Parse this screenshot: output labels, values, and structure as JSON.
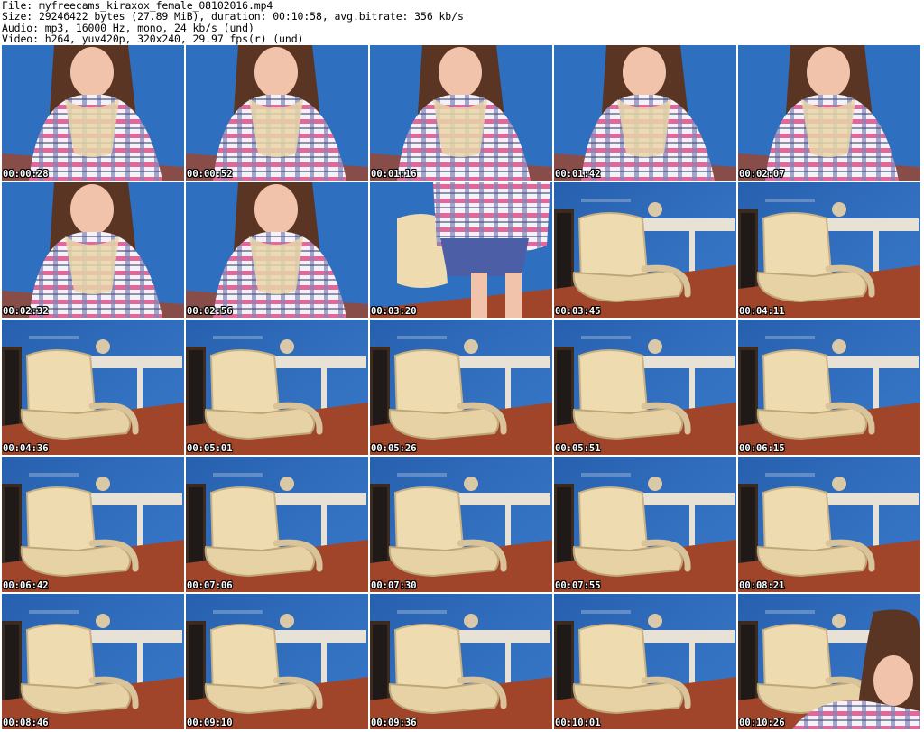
{
  "header": {
    "file_line": "File: myfreecams_kiraxox_female_08102016.mp4",
    "size_line": "Size: 29246422 bytes (27.89 MiB), duration: 00:10:58, avg.bitrate: 356 kb/s",
    "audio_line": "Audio: mp3, 16000 Hz, mono, 24 kb/s (und)",
    "video_line": "Video: h264, yuv420p, 320x240, 29.97 fps(r) (und)"
  },
  "colors": {
    "wall_blue": "#2f6fc0",
    "floor_wood": "#a0452a",
    "chair_cream": "#eedcb0",
    "shirt_pink": "#e0508c",
    "hair_brown": "#5a3524",
    "skin": "#f1c3aa"
  },
  "thumbnails": [
    {
      "time": "00:00:28",
      "scene": "person"
    },
    {
      "time": "00:00:52",
      "scene": "person"
    },
    {
      "time": "00:01:16",
      "scene": "person"
    },
    {
      "time": "00:01:42",
      "scene": "person"
    },
    {
      "time": "00:02:07",
      "scene": "person"
    },
    {
      "time": "00:02:32",
      "scene": "person"
    },
    {
      "time": "00:02:56",
      "scene": "person"
    },
    {
      "time": "00:03:20",
      "scene": "standing"
    },
    {
      "time": "00:03:45",
      "scene": "chair"
    },
    {
      "time": "00:04:11",
      "scene": "chair"
    },
    {
      "time": "00:04:36",
      "scene": "chair"
    },
    {
      "time": "00:05:01",
      "scene": "chair"
    },
    {
      "time": "00:05:26",
      "scene": "chair"
    },
    {
      "time": "00:05:51",
      "scene": "chair"
    },
    {
      "time": "00:06:15",
      "scene": "chair"
    },
    {
      "time": "00:06:42",
      "scene": "chair"
    },
    {
      "time": "00:07:06",
      "scene": "chair"
    },
    {
      "time": "00:07:30",
      "scene": "chair"
    },
    {
      "time": "00:07:55",
      "scene": "chair"
    },
    {
      "time": "00:08:21",
      "scene": "chair"
    },
    {
      "time": "00:08:46",
      "scene": "chair"
    },
    {
      "time": "00:09:10",
      "scene": "chair"
    },
    {
      "time": "00:09:36",
      "scene": "chair"
    },
    {
      "time": "00:10:01",
      "scene": "chair"
    },
    {
      "time": "00:10:26",
      "scene": "return"
    }
  ]
}
